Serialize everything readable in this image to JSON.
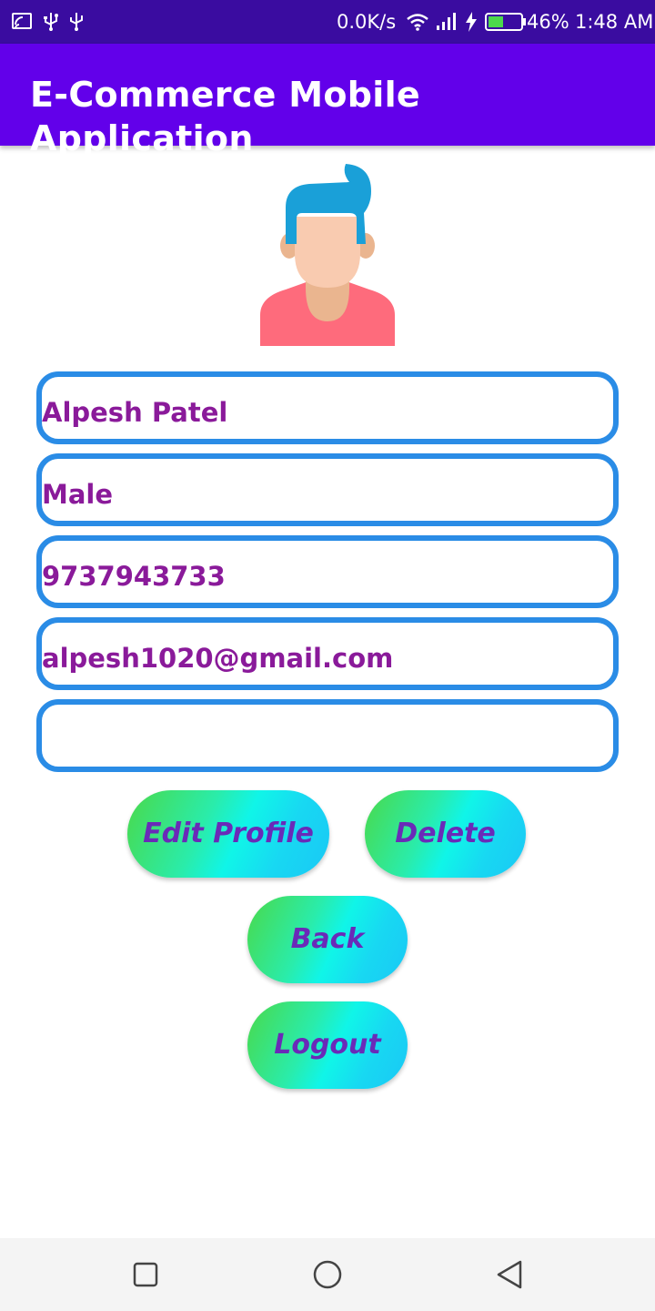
{
  "status_bar": {
    "left_icons": [
      "cast-icon",
      "usb-icon",
      "usb-icon"
    ],
    "network_speed": "0.0K/s",
    "right_icons": [
      "wifi-icon",
      "signal-icon",
      "charging-icon",
      "battery-icon"
    ],
    "battery_percent": "46%",
    "battery_level": 0.46,
    "time": "1:48 AM"
  },
  "app_bar": {
    "title": "E-Commerce Mobile Application"
  },
  "profile": {
    "avatar": "user-avatar",
    "fields": [
      {
        "name": "name",
        "value": "Alpesh Patel"
      },
      {
        "name": "gender",
        "value": "Male"
      },
      {
        "name": "phone",
        "value": "9737943733"
      },
      {
        "name": "email",
        "value": "alpesh1020@gmail.com"
      },
      {
        "name": "extra",
        "value": ""
      }
    ]
  },
  "buttons": {
    "edit_profile": "Edit Profile",
    "delete": "Delete",
    "back": "Back",
    "logout": "Logout"
  },
  "colors": {
    "status_bar": "#3a0ca0",
    "app_bar": "#6200ea",
    "field_border": "#2a8ce6",
    "field_text": "#8a1a9a",
    "button_text": "#6a2ab8",
    "button_gradient": [
      "#4ad94a",
      "#10f5e8",
      "#1ac8f5"
    ]
  },
  "nav_bar": {
    "buttons": [
      "recent-apps-icon",
      "home-icon",
      "back-icon"
    ]
  }
}
